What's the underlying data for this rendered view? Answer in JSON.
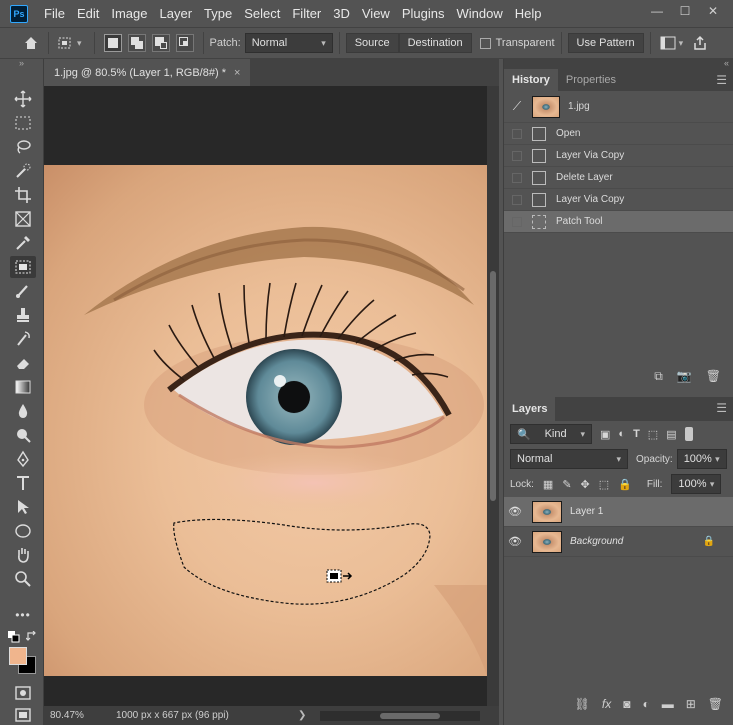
{
  "app": {
    "logo": "Ps"
  },
  "menu": [
    "File",
    "Edit",
    "Image",
    "Layer",
    "Type",
    "Select",
    "Filter",
    "3D",
    "View",
    "Plugins",
    "Window",
    "Help"
  ],
  "window_controls": {
    "minimize": "—",
    "maximize": "☐",
    "close": "✕"
  },
  "options": {
    "patch_label": "Patch:",
    "patch_value": "Normal",
    "source": "Source",
    "destination": "Destination",
    "transparent": "Transparent",
    "use_pattern": "Use Pattern"
  },
  "document": {
    "tab_title": "1.jpg @ 80.5% (Layer 1, RGB/8#) *",
    "close": "×"
  },
  "status": {
    "zoom": "80.47%",
    "info": "1000 px x 667 px (96 ppi)",
    "arrow": "❯"
  },
  "history": {
    "tabs": [
      "History",
      "Properties"
    ],
    "snapshot": "1.jpg",
    "items": [
      "Open",
      "Layer Via Copy",
      "Delete Layer",
      "Layer Via Copy",
      "Patch Tool"
    ],
    "selected_index": 4
  },
  "layers": {
    "tab": "Layers",
    "filter_kind": "Kind",
    "blend_mode": "Normal",
    "opacity_label": "Opacity:",
    "opacity_value": "100%",
    "lock_label": "Lock:",
    "fill_label": "Fill:",
    "fill_value": "100%",
    "items": [
      {
        "name": "Layer 1",
        "selected": true,
        "locked": false
      },
      {
        "name": "Background",
        "selected": false,
        "locked": true
      }
    ]
  },
  "colors": {
    "foreground": "#f0b58d",
    "background": "#000000",
    "canvas_bg": "#282828",
    "panel_bg": "#535353"
  }
}
